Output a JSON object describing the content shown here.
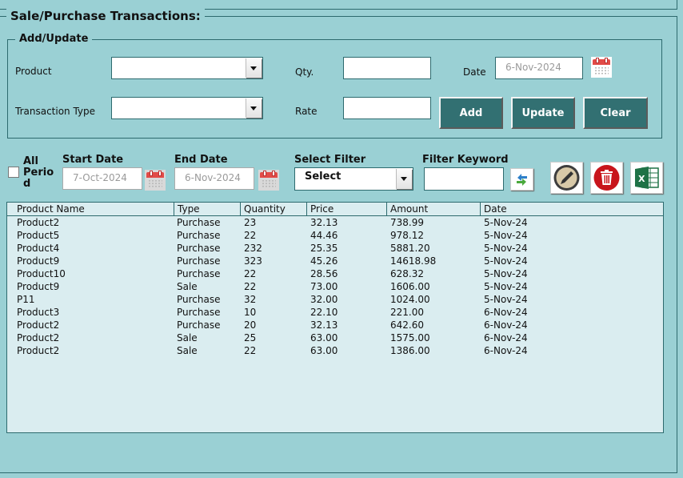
{
  "section_title": "Sale/Purchase Transactions:",
  "add_update": {
    "title": "Add/Update",
    "product_label": "Product",
    "product_value": "",
    "transaction_type_label": "Transaction Type",
    "transaction_type_value": "",
    "qty_label": "Qty.",
    "qty_value": "",
    "rate_label": "Rate",
    "rate_value": "",
    "date_label": "Date",
    "date_value": "6-Nov-2024",
    "buttons": {
      "add": "Add",
      "update": "Update",
      "clear": "Clear"
    }
  },
  "filters": {
    "all_period_label_1": "All",
    "all_period_label_2": "Perio",
    "all_period_label_3": "d",
    "all_period_checked": false,
    "start_date_label": "Start Date",
    "start_date_value": "7-Oct-2024",
    "end_date_label": "End Date",
    "end_date_value": "6-Nov-2024",
    "select_filter_label": "Select Filter",
    "select_filter_value": "Select",
    "filter_keyword_label": "Filter Keyword",
    "filter_keyword_value": ""
  },
  "colors": {
    "background": "#9ad0d4",
    "button": "#327072",
    "grid_background": "#daedf0",
    "border": "#2d6a6e"
  },
  "table": {
    "columns": [
      "Product Name",
      "Type",
      "Quantity",
      "Price",
      "Amount",
      "Date"
    ],
    "rows": [
      [
        "Product2",
        "Purchase",
        "23",
        "32.13",
        "738.99",
        "5-Nov-24"
      ],
      [
        "Product5",
        "Purchase",
        "22",
        "44.46",
        "978.12",
        "5-Nov-24"
      ],
      [
        "Product4",
        "Purchase",
        "232",
        "25.35",
        "5881.20",
        "5-Nov-24"
      ],
      [
        "Product9",
        "Purchase",
        "323",
        "45.26",
        "14618.98",
        "5-Nov-24"
      ],
      [
        "Product10",
        "Purchase",
        "22",
        "28.56",
        "628.32",
        "5-Nov-24"
      ],
      [
        "Product9",
        "Sale",
        "22",
        "73.00",
        "1606.00",
        "5-Nov-24"
      ],
      [
        "P11",
        "Purchase",
        "32",
        "32.00",
        "1024.00",
        "5-Nov-24"
      ],
      [
        "Product3",
        "Purchase",
        "10",
        "22.10",
        "221.00",
        "6-Nov-24"
      ],
      [
        "Product2",
        "Purchase",
        "20",
        "32.13",
        "642.60",
        "6-Nov-24"
      ],
      [
        "Product2",
        "Sale",
        "25",
        "63.00",
        "1575.00",
        "6-Nov-24"
      ],
      [
        "Product2",
        "Sale",
        "22",
        "63.00",
        "1386.00",
        "6-Nov-24"
      ]
    ]
  }
}
